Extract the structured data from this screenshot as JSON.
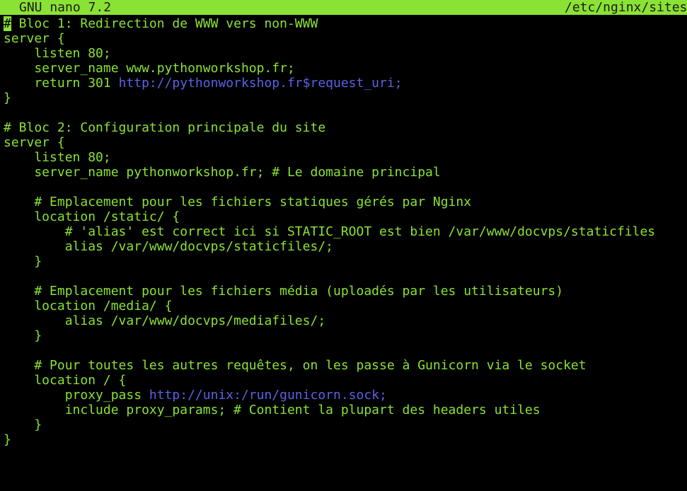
{
  "window": {
    "app_title": "GNU nano 7.2",
    "file_path": "/etc/nginx/sites"
  },
  "colors": {
    "text": "#8ae234",
    "background": "#000000",
    "titlebar_bg": "#8ae234",
    "url": "#5a62e6"
  },
  "editor": {
    "lines": [
      {
        "text": "# Bloc 1: Redirection de WWW vers non-WWW"
      },
      {
        "text": "server {"
      },
      {
        "text": "    listen 80;"
      },
      {
        "text": "    server_name www.pythonworkshop.fr;"
      },
      {
        "text": "    return 301 ",
        "url": "http://pythonworkshop.fr$request_uri;",
        "after": ""
      },
      {
        "text": "}"
      },
      {
        "text": ""
      },
      {
        "text": "# Bloc 2: Configuration principale du site"
      },
      {
        "text": "server {"
      },
      {
        "text": "    listen 80;"
      },
      {
        "text": "    server_name pythonworkshop.fr; # Le domaine principal"
      },
      {
        "text": ""
      },
      {
        "text": "    # Emplacement pour les fichiers statiques gérés par Nginx"
      },
      {
        "text": "    location /static/ {"
      },
      {
        "text": "        # 'alias' est correct ici si STATIC_ROOT est bien /var/www/docvps/staticfiles"
      },
      {
        "text": "        alias /var/www/docvps/staticfiles/;"
      },
      {
        "text": "    }"
      },
      {
        "text": ""
      },
      {
        "text": "    # Emplacement pour les fichiers média (uploadés par les utilisateurs)"
      },
      {
        "text": "    location /media/ {"
      },
      {
        "text": "        alias /var/www/docvps/mediafiles/;"
      },
      {
        "text": "    }"
      },
      {
        "text": ""
      },
      {
        "text": "    # Pour toutes les autres requêtes, on les passe à Gunicorn via le socket"
      },
      {
        "text": "    location / {"
      },
      {
        "text": "        proxy_pass ",
        "url": "http://unix:/run/gunicorn.sock;",
        "after": ""
      },
      {
        "text": "        include proxy_params; # Contient la plupart des headers utiles"
      },
      {
        "text": "    }"
      },
      {
        "text": "}"
      }
    ]
  }
}
